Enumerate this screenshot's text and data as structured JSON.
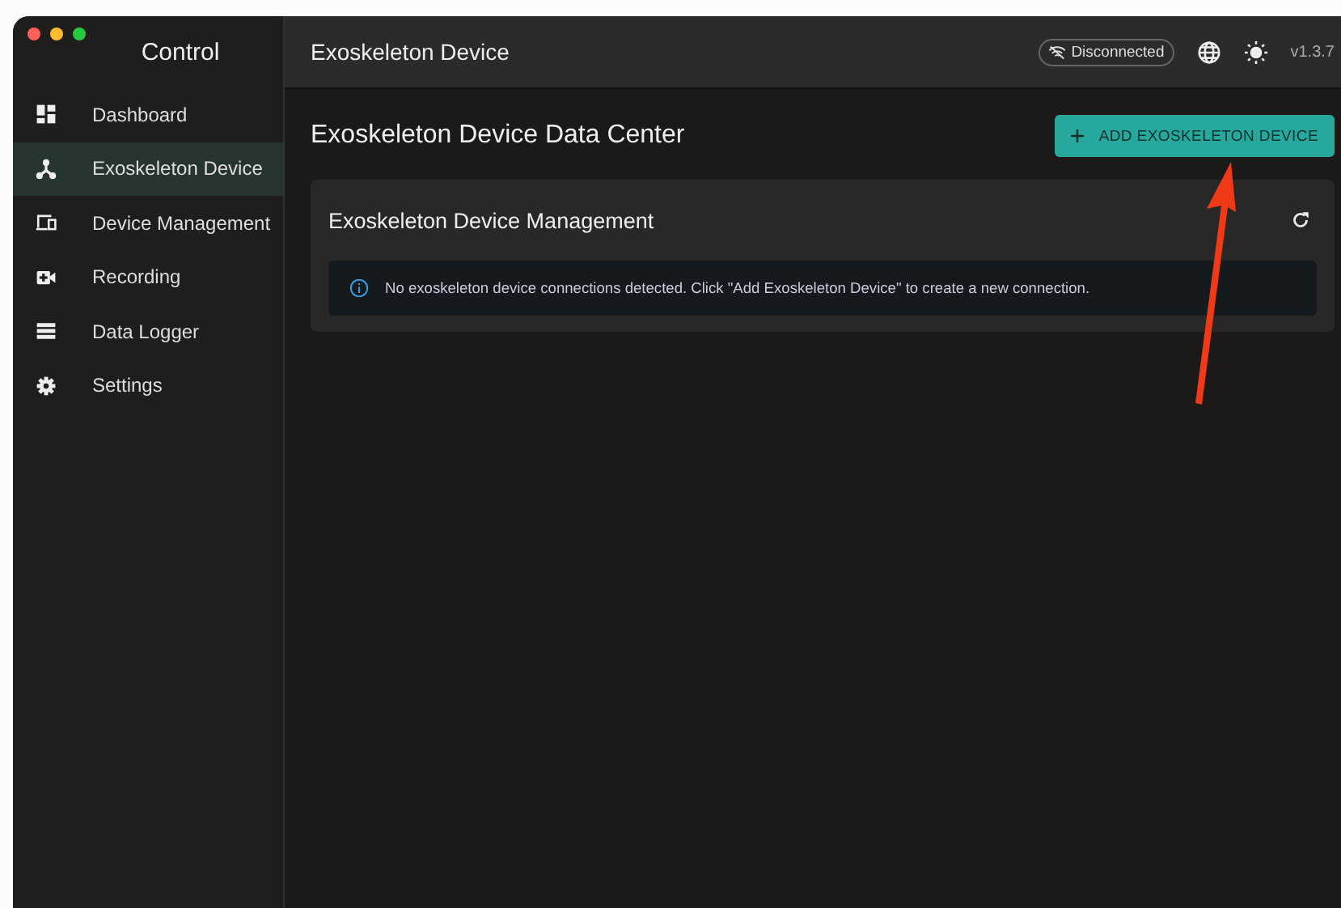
{
  "window": {
    "title": "Control"
  },
  "sidebar": {
    "items": [
      {
        "label": "Dashboard",
        "selected": false
      },
      {
        "label": "Exoskeleton Device",
        "selected": true
      },
      {
        "label": "Device Management",
        "selected": false
      },
      {
        "label": "Recording",
        "selected": false
      },
      {
        "label": "Data Logger",
        "selected": false
      },
      {
        "label": "Settings",
        "selected": false
      }
    ]
  },
  "header": {
    "title": "Exoskeleton Device",
    "status": "Disconnected",
    "version": "v1.3.7"
  },
  "page": {
    "heading": "Exoskeleton Device Data Center",
    "add_button": "ADD EXOSKELETON DEVICE",
    "card": {
      "title": "Exoskeleton Device Management",
      "alert": "No exoskeleton device connections detected. Click \"Add Exoskeleton Device\" to create a new connection."
    }
  }
}
